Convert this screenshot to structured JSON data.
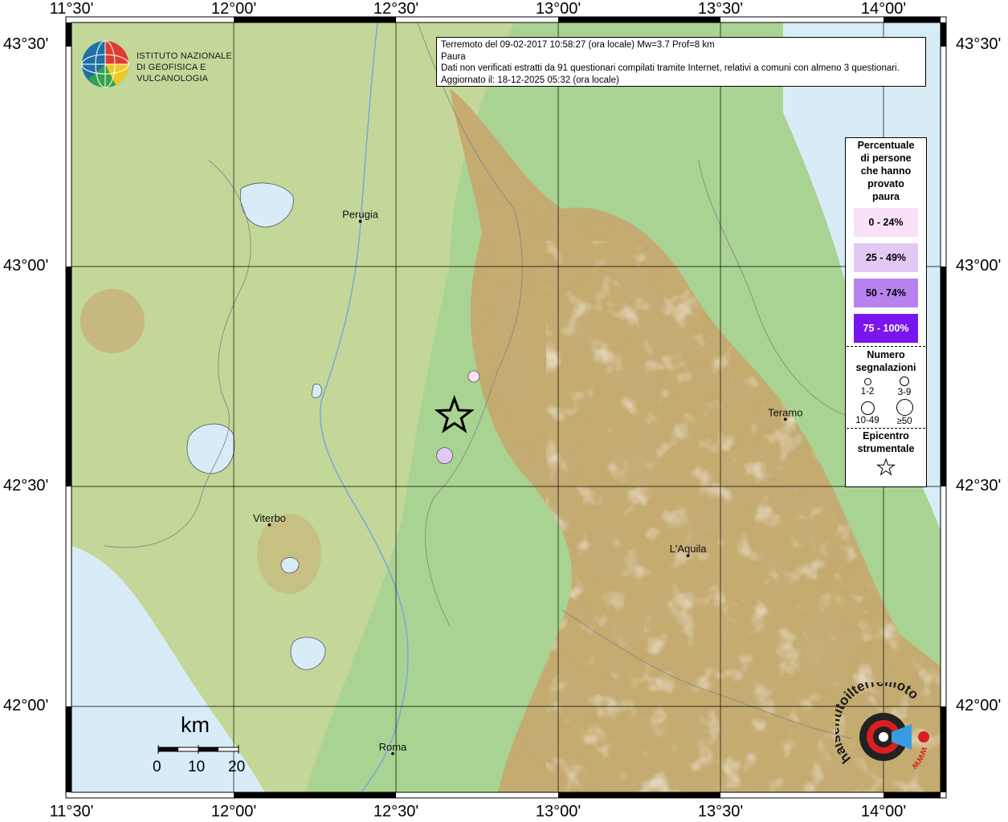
{
  "map": {
    "lon_range": [
      11.5,
      14.1
    ],
    "lat_range": [
      41.75,
      43.55
    ],
    "top_axis_labels": [
      "11°30'",
      "12°00'",
      "12°30'",
      "13°00'",
      "13°30'",
      "14°00'"
    ],
    "bottom_axis_labels": [
      "11°30'",
      "12°00'",
      "12°30'",
      "13°00'",
      "13°30'",
      "14°00'"
    ],
    "left_axis_labels": [
      "43°30'",
      "43°00'",
      "42°30'",
      "42°00'"
    ],
    "right_axis_labels": [
      "43°30'",
      "43°00'",
      "42°30'",
      "42°00'"
    ],
    "colors": {
      "sea": "#d8ecf7",
      "lowland": "#a9d392",
      "hill": "#c9d89a",
      "mountain": "#c9a36a",
      "peak": "#f3eee4"
    }
  },
  "info": {
    "line1": "Terremoto del 09-02-2017 10:58:27 (ora locale) Mw=3.7 Prof=8 km",
    "line2": "Paura",
    "line3": "Dati non verificati estratti da 91 questionari compilati tramite Internet, relativi a comuni con almeno 3 questionari.",
    "line4": "Aggiornato il: 18-12-2025 05:32 (ora locale)"
  },
  "legend": {
    "title_lines": [
      "Percentuale",
      "di persone",
      "che hanno",
      "provato",
      "paura"
    ],
    "classes": [
      {
        "label": "0 - 24%",
        "color": "#fae1f7",
        "text_color": "#000000"
      },
      {
        "label": "25 - 49%",
        "color": "#e3c8f6",
        "text_color": "#000000"
      },
      {
        "label": "50 - 74%",
        "color": "#b882ee",
        "text_color": "#000000"
      },
      {
        "label": "75 - 100%",
        "color": "#7b15f0",
        "text_color": "#ffffff"
      }
    ],
    "count_title_lines": [
      "Numero",
      "segnalazioni"
    ],
    "counts": [
      "1-2",
      "3-9",
      "10-49",
      "≥50"
    ],
    "epicenter_title_lines": [
      "Epicentro",
      "strumentale"
    ]
  },
  "cities": [
    {
      "name": "Perugia",
      "lon": 12.39,
      "lat": 43.11
    },
    {
      "name": "Viterbo",
      "lon": 12.11,
      "lat": 42.42
    },
    {
      "name": "Roma",
      "lon": 12.49,
      "lat": 41.9
    },
    {
      "name": "L'Aquila",
      "lon": 13.4,
      "lat": 42.35
    },
    {
      "name": "Teramo",
      "lon": 13.7,
      "lat": 42.66
    }
  ],
  "observations": [
    {
      "lon": 12.74,
      "lat": 42.75,
      "class": 0,
      "count_class": 0
    },
    {
      "lon": 12.65,
      "lat": 42.57,
      "class": 1,
      "count_class": 1
    }
  ],
  "epicenter": {
    "lon": 12.68,
    "lat": 42.66
  },
  "scale": {
    "unit": "km",
    "ticks": [
      "0",
      "10",
      "20"
    ]
  },
  "logo_ingv": {
    "line1": "ISTITUTO NAZIONALE",
    "line2": "DI GEOFISICA E VULCANOLOGIA"
  },
  "logo_hsit": {
    "text": "haisentitoilterremoto.it",
    "www": "www"
  }
}
